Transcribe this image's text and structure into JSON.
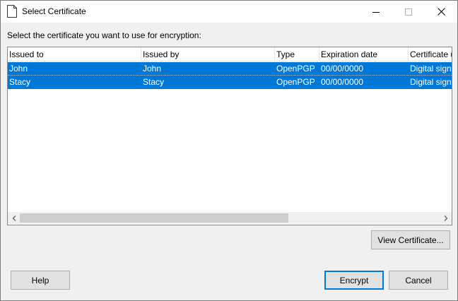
{
  "window": {
    "title": "Select Certificate"
  },
  "prompt": "Select the certificate you want to use for encryption:",
  "table": {
    "columns": [
      "Issued to",
      "Issued by",
      "Type",
      "Expiration date",
      "Certificate u"
    ],
    "rows": [
      [
        "John",
        "John",
        "OpenPGP",
        "00/00/0000",
        "Digital signa"
      ],
      [
        "Stacy",
        "Stacy",
        "OpenPGP",
        "00/00/0000",
        "Digital signa"
      ]
    ],
    "selection_color": "#0078d7"
  },
  "buttons": {
    "view_certificate": "View Certificate...",
    "help": "Help",
    "encrypt": "Encrypt",
    "cancel": "Cancel"
  },
  "icons": {
    "app": "document-icon",
    "minimize": "minimize-icon",
    "maximize": "maximize-icon",
    "close": "close-icon",
    "scroll_left": "chevron-left-icon",
    "scroll_right": "chevron-right-icon"
  }
}
